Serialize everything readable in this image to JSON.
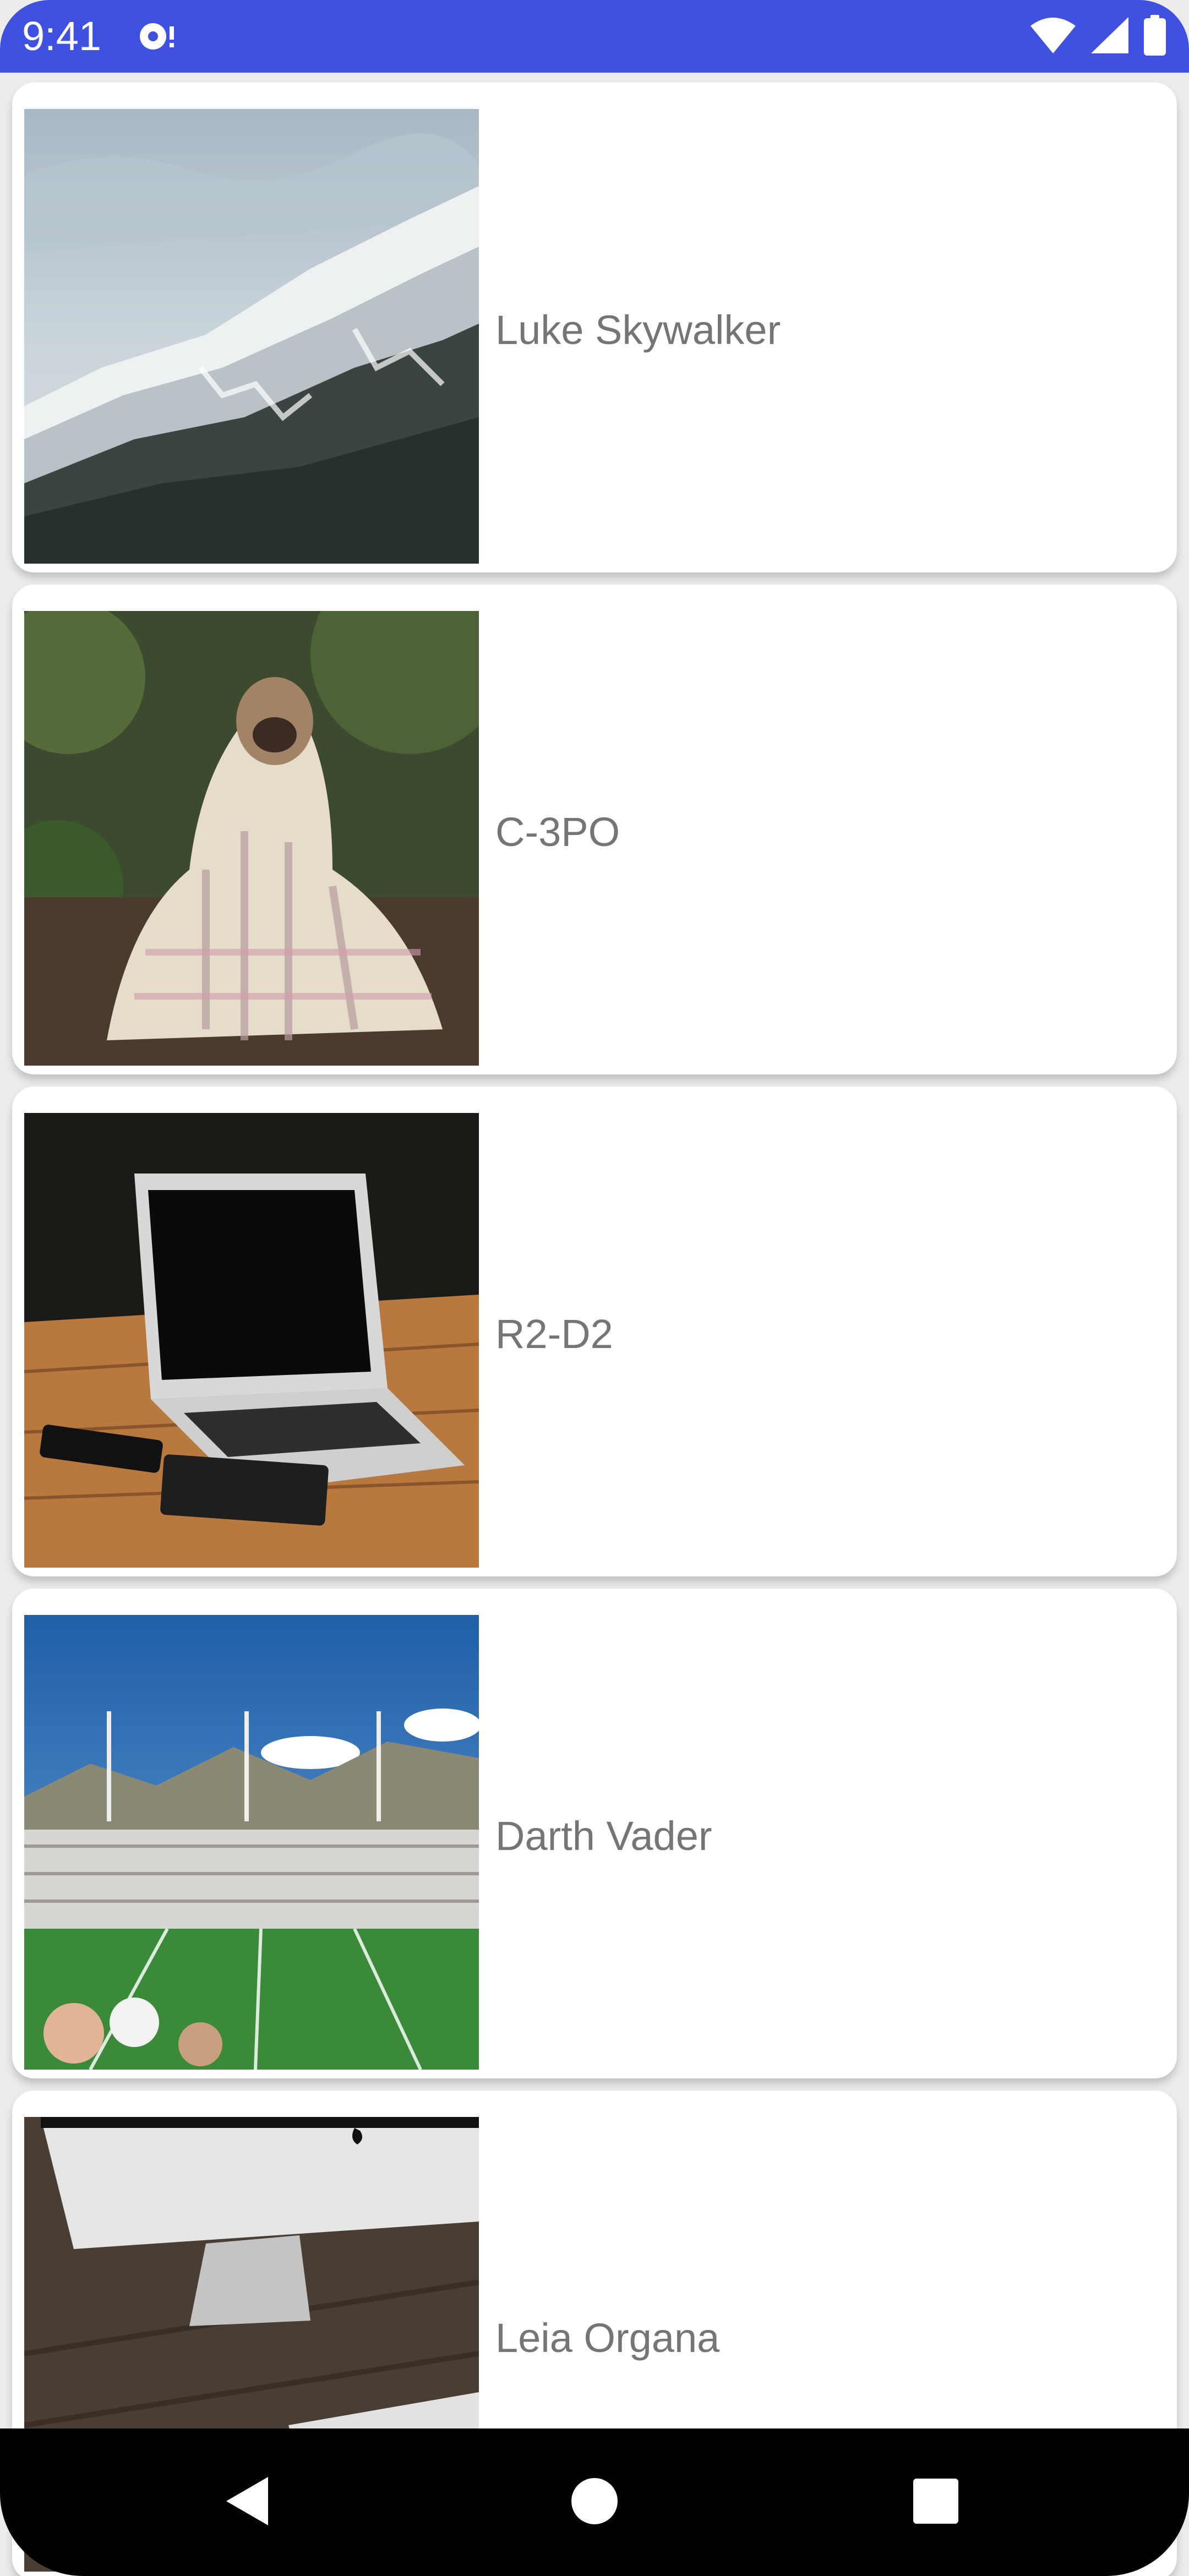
{
  "status_bar": {
    "time": "9:41",
    "background": "#3f51e0",
    "icons": [
      "notification-icon",
      "wifi-icon",
      "cell-signal-icon",
      "battery-icon"
    ]
  },
  "list": {
    "items": [
      {
        "name": "Luke Skywalker",
        "image": "snowy-mountain-photo"
      },
      {
        "name": "C-3PO",
        "image": "pug-in-blanket-photo"
      },
      {
        "name": "R2-D2",
        "image": "laptop-on-desk-photo"
      },
      {
        "name": "Darth Vader",
        "image": "stadium-crowd-photo"
      },
      {
        "name": "Leia Organa",
        "image": "imac-desk-photo"
      }
    ],
    "label_color": "#757575"
  },
  "nav_bar": {
    "buttons": [
      "back-icon",
      "home-icon",
      "recents-icon"
    ]
  }
}
